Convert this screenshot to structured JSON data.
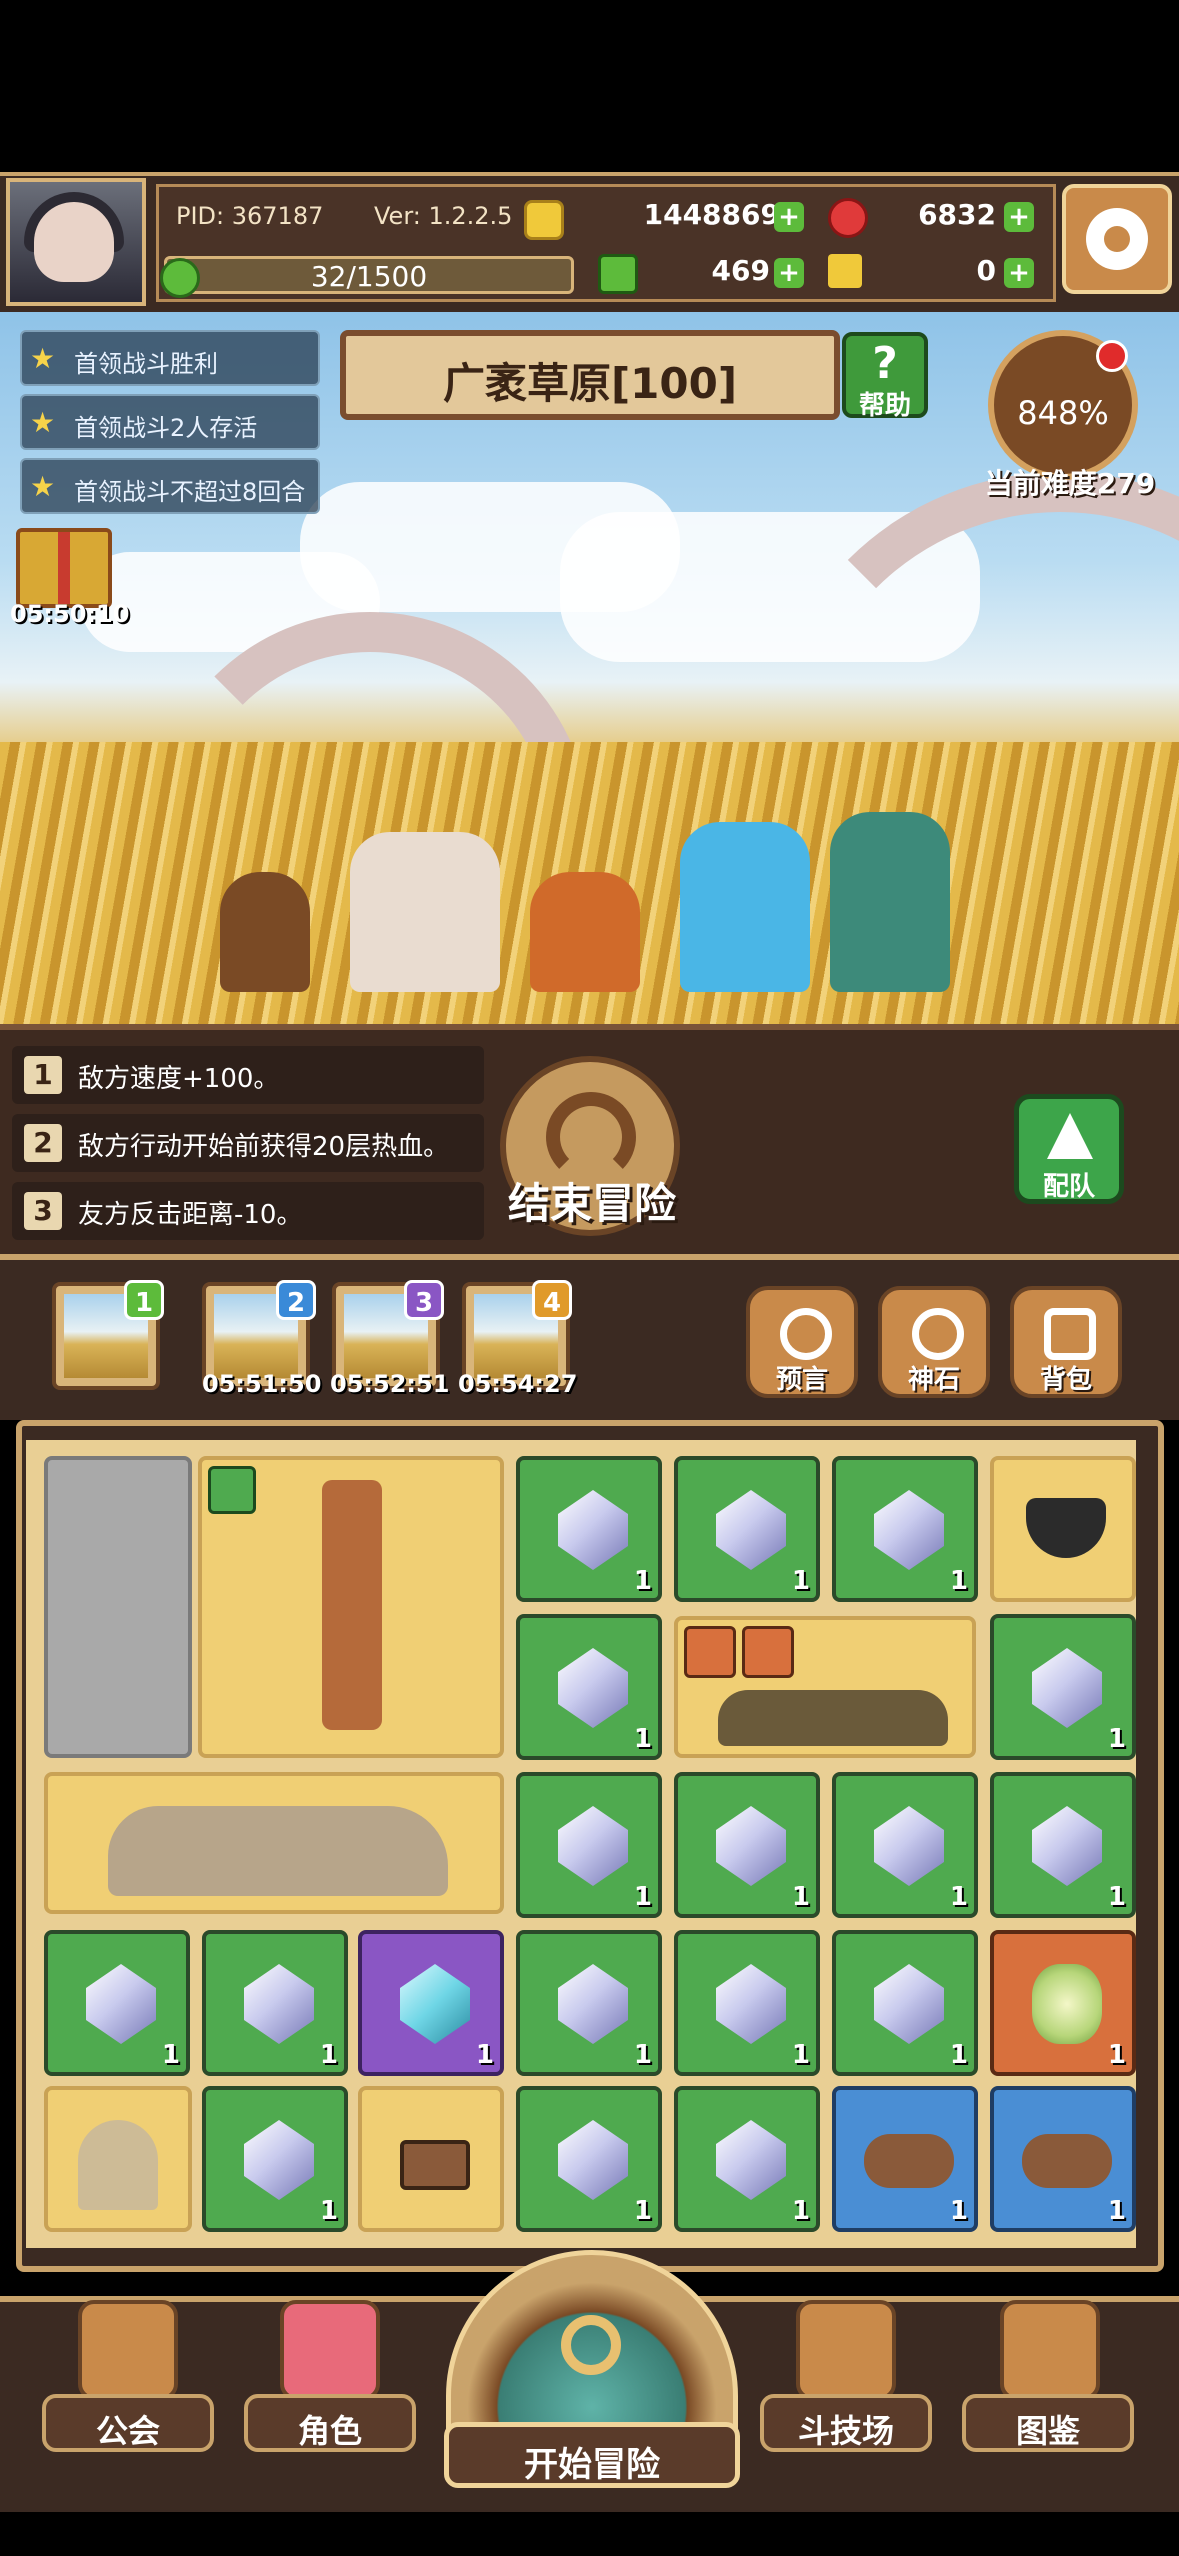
{
  "header": {
    "pid": "PID: 367187",
    "version": "Ver: 1.2.2.5",
    "gold": "1448869",
    "red_gem": "6832",
    "energy": "32/1500",
    "clover": "469",
    "key": "0"
  },
  "quests": [
    "首领战斗胜利",
    "首领战斗2人存活",
    "首领战斗不超过8回合"
  ],
  "stage": {
    "title": "广袤草原[100]",
    "help_label": "帮助"
  },
  "difficulty": {
    "percent": "848%",
    "label": "当前难度279"
  },
  "gift_timer": "05:50:10",
  "buffs": [
    {
      "num": "1",
      "text": "敌方速度+100。"
    },
    {
      "num": "2",
      "text": "敌方行动开始前获得20层热血。"
    },
    {
      "num": "3",
      "text": "友方反击距离-10。"
    }
  ],
  "end_button": "结束冒险",
  "team_button": "配队",
  "slots": [
    {
      "badge": "1",
      "timer": ""
    },
    {
      "badge": "2",
      "timer": "05:51:50"
    },
    {
      "badge": "3",
      "timer": "05:52:51"
    },
    {
      "badge": "4",
      "timer": "05:54:27"
    }
  ],
  "actions": [
    "预言",
    "神石",
    "背包"
  ],
  "item_qty": "1",
  "nav": [
    "公会",
    "角色",
    "开始冒险",
    "斗技场",
    "图鉴"
  ],
  "colors": {
    "green_cell": "#4faa4f",
    "purple_cell": "#8a56c4",
    "orange_cell": "#d8703d",
    "blue_cell": "#4a8ed4",
    "frame": "#c9a36b"
  }
}
